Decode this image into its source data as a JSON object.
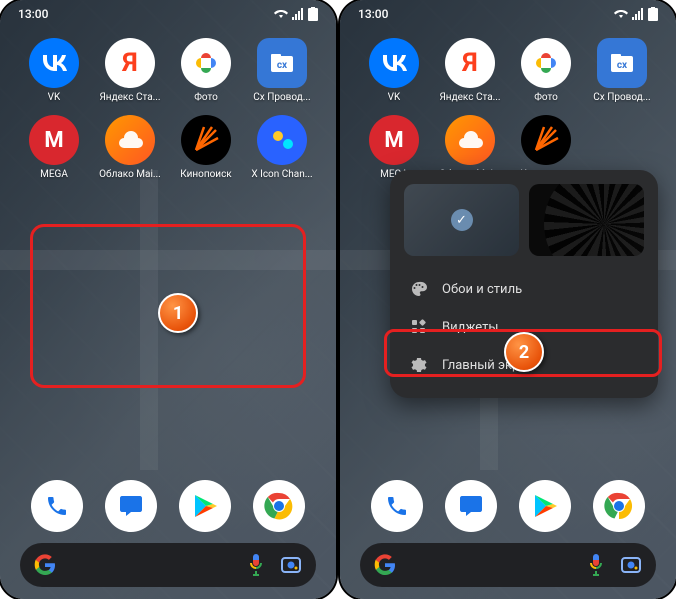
{
  "status": {
    "time": "13:00"
  },
  "apps": {
    "row1": [
      {
        "label": "VK",
        "icon": "vk"
      },
      {
        "label": "Яндекс Ста...",
        "icon": "yandex"
      },
      {
        "label": "Фото",
        "icon": "photo"
      },
      {
        "label": "Cx Провод...",
        "icon": "cx"
      }
    ],
    "row2": [
      {
        "label": "MEGA",
        "icon": "mega"
      },
      {
        "label": "Облако Mai...",
        "icon": "mail"
      },
      {
        "label": "Кинопоиск",
        "icon": "kino"
      },
      {
        "label": "X Icon Chan...",
        "icon": "xicon"
      }
    ]
  },
  "dock": [
    {
      "name": "phone"
    },
    {
      "name": "messages"
    },
    {
      "name": "play"
    },
    {
      "name": "chrome"
    }
  ],
  "callouts": {
    "one": "1",
    "two": "2"
  },
  "context_menu": {
    "wallpaper_style": "Обои и стиль",
    "widgets": "Виджеты",
    "home_screen": "Главный экран"
  }
}
